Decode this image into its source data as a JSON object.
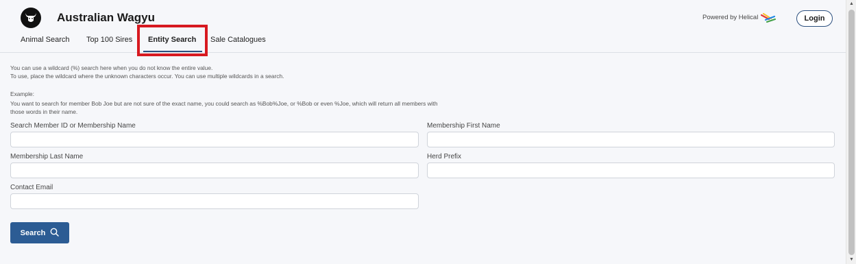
{
  "header": {
    "title": "Australian Wagyu",
    "powered_by": "Powered by Helical",
    "login_label": "Login"
  },
  "tabs": [
    {
      "label": "Animal Search"
    },
    {
      "label": "Top 100 Sires"
    },
    {
      "label": "Entity Search",
      "active": true
    },
    {
      "label": "Sale Catalogues"
    }
  ],
  "help": {
    "line1": "You can use a wildcard (%) search here when you do not know the entire value.",
    "line2": "To use, place the wildcard where the unknown characters occur. You can use multiple wildcards in a search.",
    "example_heading": "Example:",
    "example_line1": "You want to search for member Bob Joe but are not sure of the exact name, you could search as %Bob%Joe, or %Bob or even %Joe, which will return all members with",
    "example_line2": "those words in their name."
  },
  "form": {
    "member_id_label": "Search Member ID or Membership Name",
    "member_id_value": "",
    "first_name_label": "Membership First Name",
    "first_name_value": "",
    "last_name_label": "Membership Last Name",
    "last_name_value": "",
    "herd_prefix_label": "Herd Prefix",
    "herd_prefix_value": "",
    "contact_email_label": "Contact Email",
    "contact_email_value": "",
    "search_label": "Search"
  },
  "colors": {
    "primary": "#2c5c94",
    "highlight": "#d71920",
    "background": "#f6f7fa"
  },
  "icons": {
    "logo": "bull-head-icon",
    "brand": "helical-logo-icon",
    "search": "search-icon"
  }
}
